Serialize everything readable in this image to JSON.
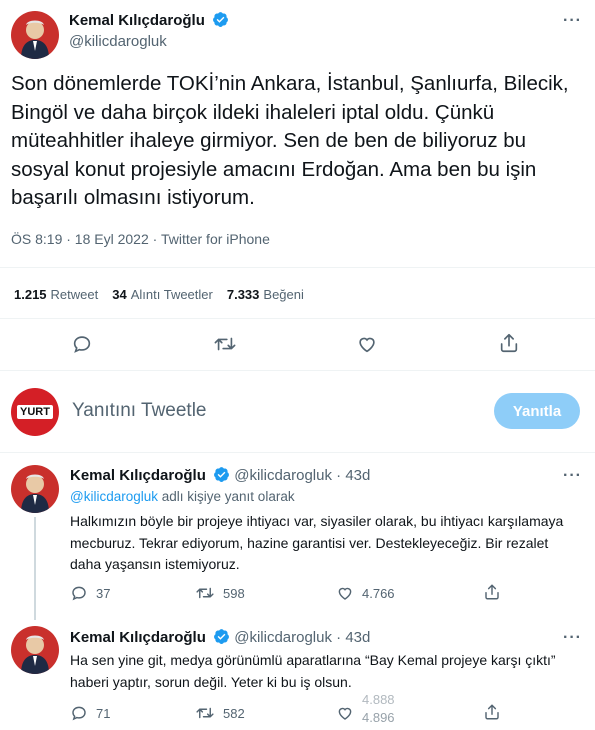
{
  "main_tweet": {
    "author_name": "Kemal Kılıçdaroğlu",
    "handle": "@kilicdarogluk",
    "text": "Son dönemlerde TOKİ’nin Ankara, İstanbul, Şanlıurfa, Bilecik, Bingöl ve daha birçok ildeki ihaleleri iptal oldu. Çünkü müteahhitler ihaleye girmiyor. Sen de ben de biliyoruz bu sosyal konut projesiyle amacını Erdoğan. Ama ben bu işin başarılı olmasını istiyorum.",
    "meta": "ÖS 8:19 · 18 Eyl 2022 · Twitter for iPhone",
    "retweets": "1.215",
    "retweets_label": "Retweet",
    "quotes": "34",
    "quotes_label": "Alıntı Tweetler",
    "likes": "7.333",
    "likes_label": "Beğeni"
  },
  "compose": {
    "avatar_text": "YURT",
    "placeholder": "Yanıtını Tweetle",
    "button_label": "Yanıtla"
  },
  "replies": [
    {
      "author_name": "Kemal Kılıçdaroğlu",
      "handle": "@kilicdarogluk",
      "time": "· 43d",
      "reply_to_user": "@kilicdarogluk",
      "reply_to_suffix": "adlı kişiye yanıt olarak",
      "text": "Halkımızın böyle bir projeye ihtiyacı var, siyasiler olarak, bu ihtiyacı karşılamaya mecburuz. Tekrar ediyorum, hazine garantisi ver. Destekleyeceğiz. Bir rezalet daha yaşansın istemiyoruz.",
      "replies": "37",
      "retweets": "598",
      "likes": "4.766"
    },
    {
      "author_name": "Kemal Kılıçdaroğlu",
      "handle": "@kilicdarogluk",
      "time": "· 43d",
      "text": "Ha sen yine git, medya görünümlü aparatlarına “Bay Kemal projeye karşı çıktı” haberi yaptır, sorun değil. Yeter ki bu iş olsun.",
      "replies": "71",
      "retweets": "582",
      "likes_old": "4.888",
      "likes": "4.896"
    }
  ],
  "colors": {
    "brand_blue": "#1d9bf0",
    "gray_text": "#536471",
    "divider": "#eff3f4",
    "button_disabled": "#8ecdf8"
  }
}
